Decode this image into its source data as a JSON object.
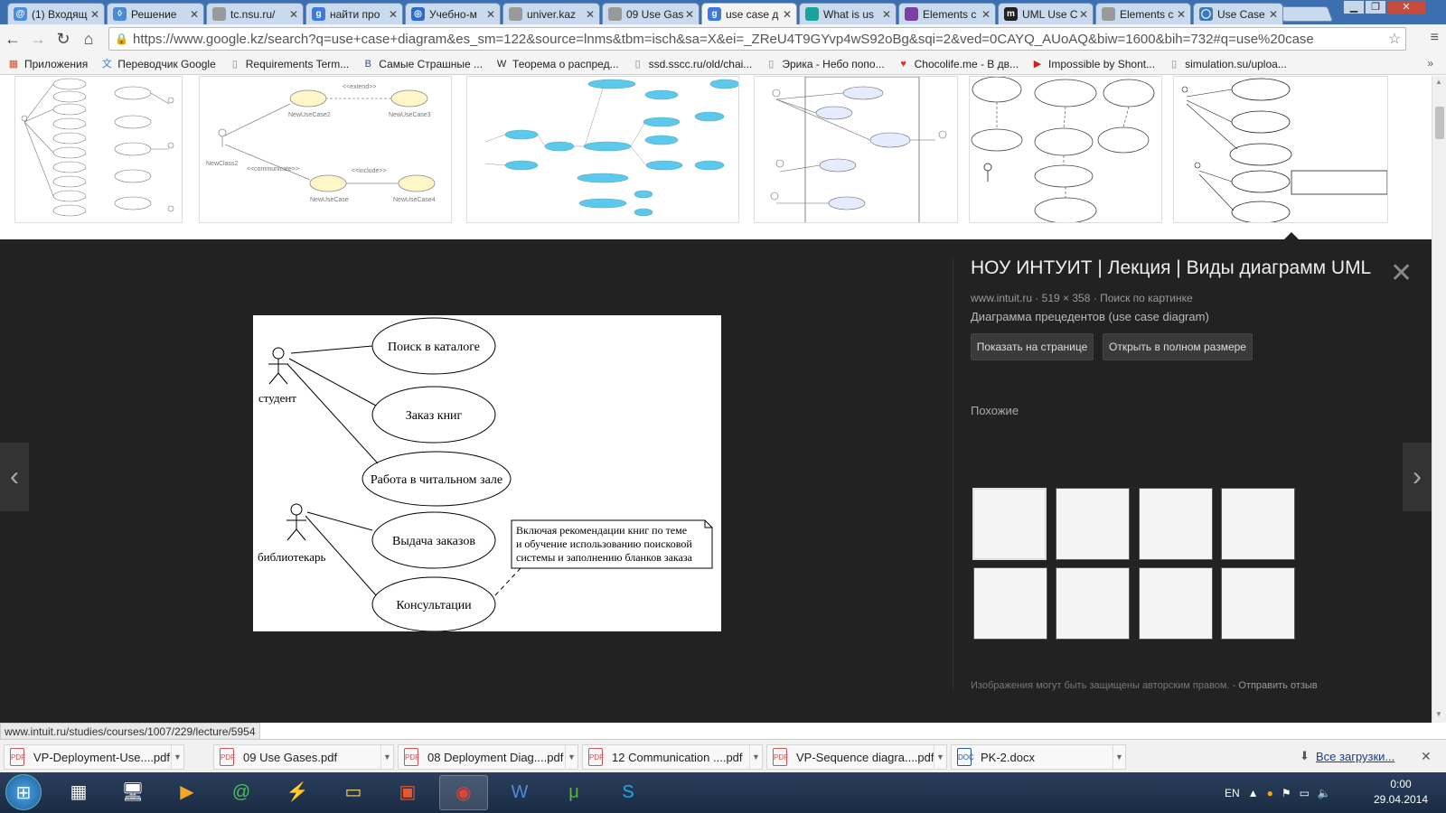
{
  "tabs": [
    {
      "title": "(1) Входящ",
      "icon_color": "#4a8ee0",
      "glyph": "@"
    },
    {
      "title": "Решение",
      "icon_color": "#4b8bd4",
      "glyph": "◊"
    },
    {
      "title": "tc.nsu.ru/",
      "icon_color": "#999999",
      "glyph": ""
    },
    {
      "title": "найти про",
      "icon_color": "#3b7be0",
      "glyph": "g"
    },
    {
      "title": "Учебно-м",
      "icon_color": "#2a6bd0",
      "glyph": "◎"
    },
    {
      "title": "univer.kaz",
      "icon_color": "#999999",
      "glyph": ""
    },
    {
      "title": "09 Use Gas",
      "icon_color": "#999999",
      "glyph": ""
    },
    {
      "title": "use case д",
      "icon_color": "#3b7be0",
      "glyph": "g",
      "active": true
    },
    {
      "title": "What is us",
      "icon_color": "#1aa39a",
      "glyph": ""
    },
    {
      "title": "Elements c",
      "icon_color": "#7a3fa0",
      "glyph": ""
    },
    {
      "title": "UML Use C",
      "icon_color": "#222222",
      "glyph": "m"
    },
    {
      "title": "Elements c",
      "icon_color": "#999999",
      "glyph": ""
    },
    {
      "title": "Use Case D",
      "icon_color": "#3a7ab8",
      "glyph": "◯"
    }
  ],
  "window": {
    "minimize": "▁",
    "maximize": "❐",
    "close": "✕"
  },
  "toolbar": {
    "back": "←",
    "forward": "→",
    "reload": "↻",
    "home": "⌂",
    "url": "https://www.google.kz/search?q=use+case+diagram&es_sm=122&source=lnms&tbm=isch&sa=X&ei=_ZReU4T9GYvp4wS92oBg&sqi=2&ved=0CAYQ_AUoAQ&biw=1600&bih=732#q=use%20case",
    "star": "☆",
    "menu": "≡"
  },
  "bookmarks": [
    {
      "label": "Приложения",
      "icon": "▦",
      "color": "#d04b2a"
    },
    {
      "label": "Переводчик Google",
      "icon": "文",
      "color": "#3b7be0"
    },
    {
      "label": "Requirements Term...",
      "icon": "▯",
      "color": "#888888"
    },
    {
      "label": "Самые Страшные ...",
      "icon": "B",
      "color": "#2b4f9c"
    },
    {
      "label": "Теорема о распред...",
      "icon": "W",
      "color": "#222222"
    },
    {
      "label": "ssd.sscc.ru/old/chai...",
      "icon": "▯",
      "color": "#888888"
    },
    {
      "label": "Эрика - Небо попо...",
      "icon": "▯",
      "color": "#888888"
    },
    {
      "label": "Chocolife.me - В дв...",
      "icon": "♥",
      "color": "#e0302a"
    },
    {
      "label": "Impossible by Shont...",
      "icon": "▶",
      "color": "#cc2222"
    },
    {
      "label": "simulation.su/uploa...",
      "icon": "▯",
      "color": "#888888"
    }
  ],
  "bookmarks_more": "»",
  "diagram": {
    "actors": [
      "студент",
      "библиотекарь"
    ],
    "usecases": [
      "Поиск в каталоге",
      "Заказ книг",
      "Работа в читальном зале",
      "Выдача заказов",
      "Консультации"
    ],
    "note": [
      "Включая рекомендации книг по теме",
      "и обучение использованию поисковой",
      "системы и заполнению бланков заказа"
    ]
  },
  "viewer": {
    "title": "НОУ ИНТУИТ | Лекция | Виды диаграмм UML",
    "meta": "www.intuit.ru · 519 × 358 · Поиск по картинке",
    "description": "Диаграмма прецедентов (use case diagram)",
    "btn_show": "Показать на странице",
    "btn_open": "Открыть в полном размере",
    "similar_label": "Похожие",
    "disclaimer": "Изображения могут быть защищены авторским правом.",
    "feedback": "Отправить отзыв",
    "close": "✕",
    "prev": "‹",
    "next": "›"
  },
  "status_url": "www.intuit.ru/studies/courses/1007/229/lecture/5954",
  "downloads": [
    {
      "name": "VP-Deployment-Use....pdf",
      "type": "PDF"
    },
    {
      "name": "09 Use Gases.pdf",
      "type": "PDF"
    },
    {
      "name": "08 Deployment Diag....pdf",
      "type": "PDF"
    },
    {
      "name": "12 Communication ....pdf",
      "type": "PDF"
    },
    {
      "name": "VP-Sequence diagra....pdf",
      "type": "PDF"
    },
    {
      "name": "PK-2.docx",
      "type": "DOC"
    }
  ],
  "all_downloads": "Все загрузки...",
  "taskbar": {
    "lang": "EN",
    "time": "0:00",
    "date": "29.04.2014"
  }
}
